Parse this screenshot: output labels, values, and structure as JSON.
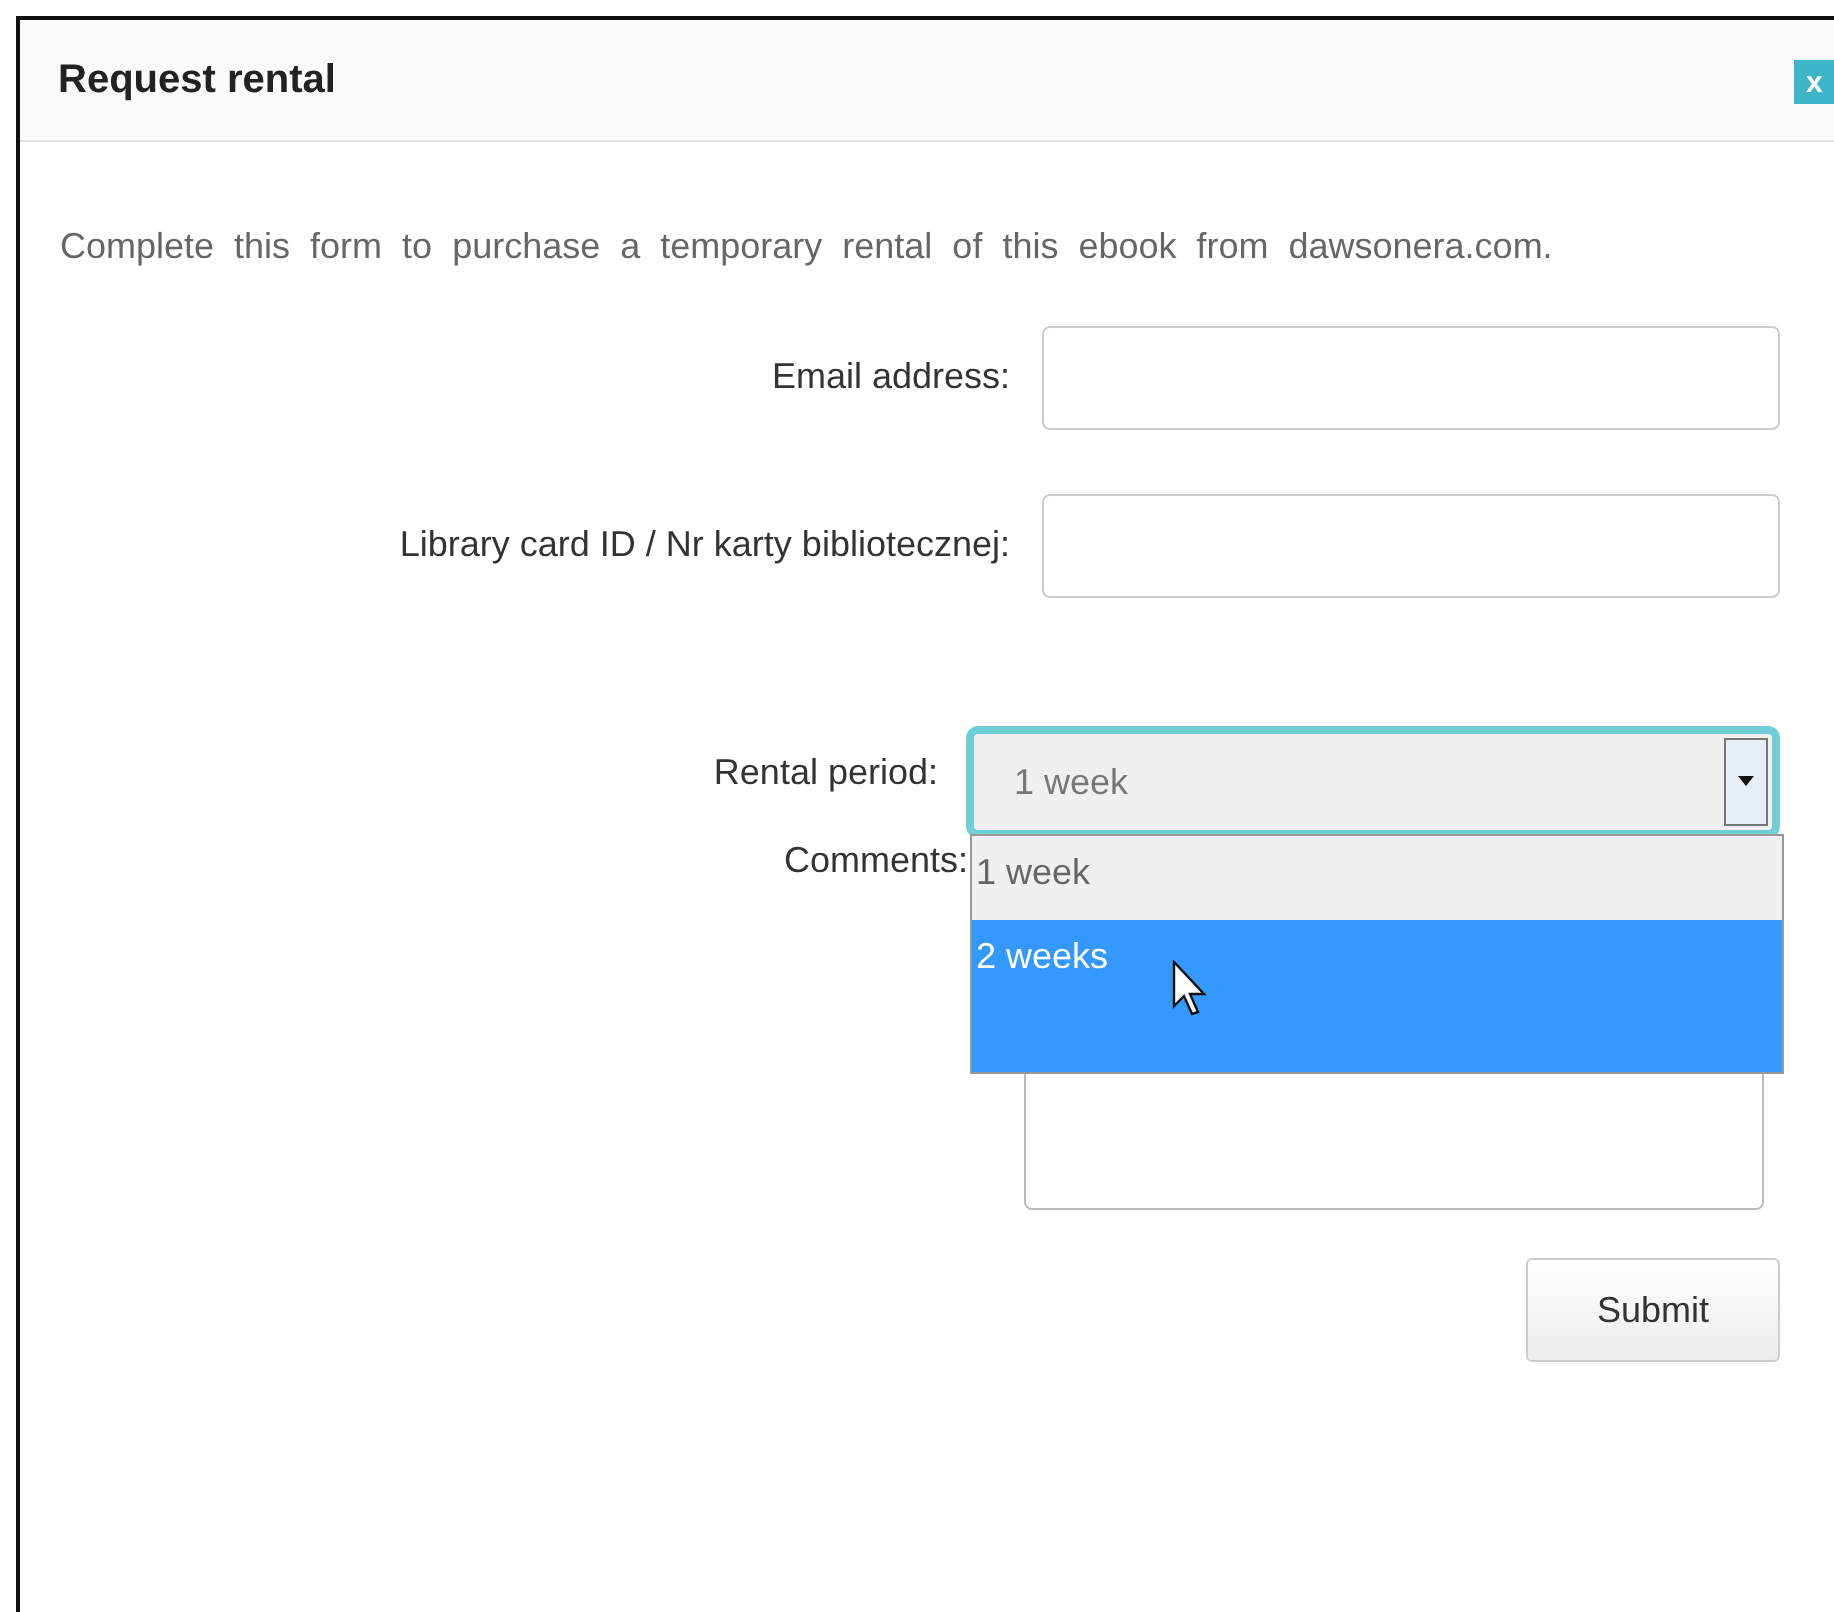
{
  "dialog": {
    "title": "Request rental",
    "close": "x"
  },
  "intro": "Complete this form to purchase a temporary rental of this ebook from dawsonera.com.",
  "fields": [
    {
      "kind": "text",
      "label": "Email address:"
    },
    {
      "kind": "text",
      "label": "Library card ID / Nr karty bibliotecznej:"
    },
    {
      "kind": "select",
      "label": "Rental period:",
      "value": "1 week",
      "expanded": true,
      "options": [
        {
          "label": "1 week",
          "highlighted": false
        },
        {
          "label": "2 weeks",
          "highlighted": true
        }
      ]
    },
    {
      "kind": "textarea",
      "label": "Comments:"
    }
  ],
  "submit": "Submit"
}
